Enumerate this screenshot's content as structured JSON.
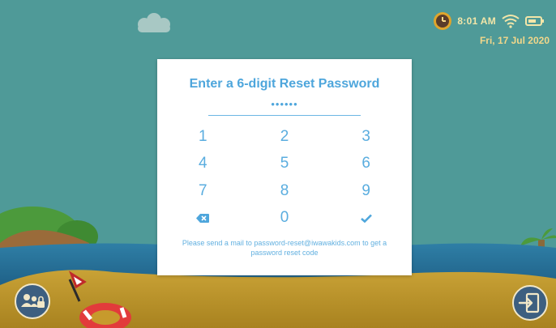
{
  "status_bar": {
    "time": "8:01 AM",
    "date": "Fri, 17 Jul 2020",
    "icons": [
      "clock-icon",
      "wifi-icon",
      "battery-icon"
    ]
  },
  "reset_dialog": {
    "title": "Enter a 6-digit Reset Password",
    "pin_mask": "••••••",
    "keys": [
      "1",
      "2",
      "3",
      "4",
      "5",
      "6",
      "7",
      "8",
      "9",
      "backspace",
      "0",
      "confirm"
    ],
    "note": "Please send a mail to password-reset@iwawakids.com to get a password reset code",
    "accent_color": "#4ea6dc"
  },
  "corner_buttons": {
    "left_icon": "users-lock-icon",
    "right_icon": "exit-door-icon"
  }
}
